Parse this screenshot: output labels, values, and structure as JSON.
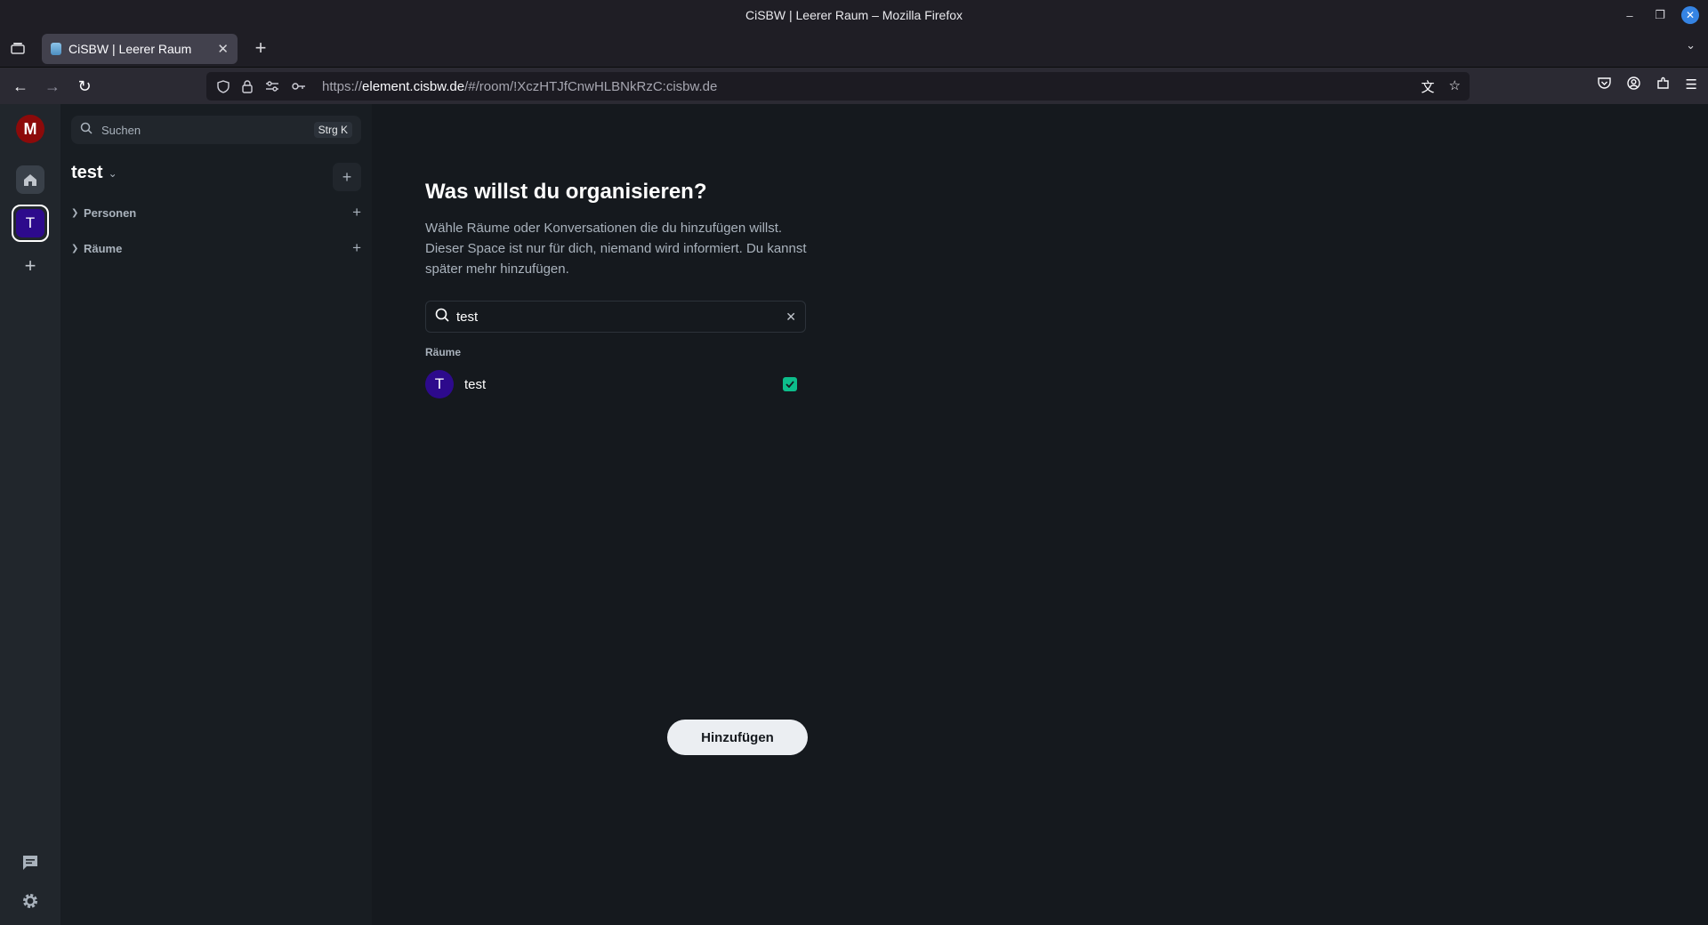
{
  "window": {
    "title": "CiSBW | Leerer Raum – Mozilla Firefox"
  },
  "tab": {
    "title": "CiSBW | Leerer Raum"
  },
  "urlbar": {
    "prefix": "https://",
    "host": "element.cisbw.de",
    "path": "/#/room/!XczHTJfCnwHLBNkRzC:cisbw.de"
  },
  "spacebar": {
    "user_initial": "M",
    "space_initial": "T"
  },
  "roomlist": {
    "search_label": "Suchen",
    "search_shortcut": "Strg K",
    "space_name": "test",
    "sections": [
      {
        "label": "Personen"
      },
      {
        "label": "Räume"
      }
    ]
  },
  "main": {
    "heading": "Was willst du organisieren?",
    "description": "Wähle Räume oder Konversationen die du hinzufügen willst. Dieser Space ist nur für dich, niemand wird informiert. Du kannst später mehr hinzufügen.",
    "filter_value": "test",
    "group_label": "Räume",
    "results": [
      {
        "initial": "T",
        "name": "test",
        "checked": true
      }
    ],
    "submit_label": "Hinzufügen"
  },
  "colors": {
    "accent": "#0dbd8b",
    "space_avatar": "#2d0a8c",
    "user_avatar": "#8c0a0a"
  }
}
